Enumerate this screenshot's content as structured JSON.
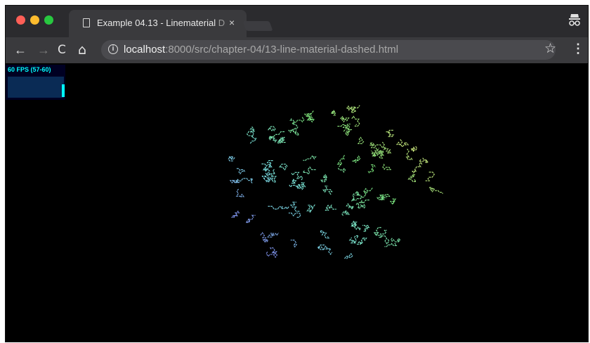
{
  "tab": {
    "title": "Example 04.13 - Linematerial",
    "title_faded": "D",
    "close_glyph": "×"
  },
  "nav": {
    "back": "←",
    "forward": "→",
    "reload": "C",
    "home": "⌂"
  },
  "address": {
    "host": "localhost",
    "path": ":8000/src/chapter-04/13-line-material-dashed.html"
  },
  "toolbar": {
    "star": "☆",
    "menu": "⋮"
  },
  "stats": {
    "label": "60 FPS (57-60)"
  },
  "colors": {
    "tabbar": "#2b2b2e",
    "toolbar": "#3a3a3d",
    "canvas": "#000000",
    "stats_text": "#00ffff",
    "stats_bg": "#000022"
  }
}
